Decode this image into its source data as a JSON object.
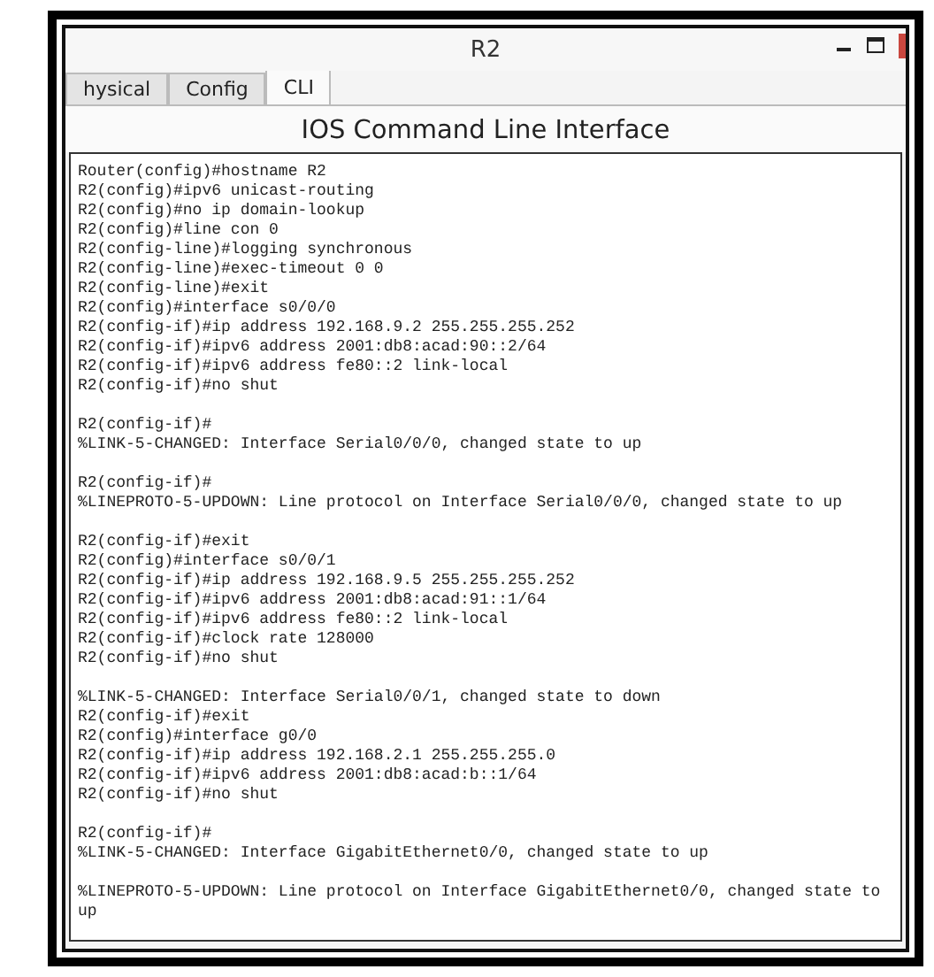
{
  "window": {
    "title": "R2"
  },
  "tabs": [
    {
      "label": "hysical",
      "selected": false
    },
    {
      "label": "Config",
      "selected": false
    },
    {
      "label": "CLI",
      "selected": true
    }
  ],
  "header": "IOS Command Line Interface",
  "console_blocks": [
    [
      "Router(config)#hostname R2",
      "R2(config)#ipv6 unicast-routing",
      "R2(config)#no ip domain-lookup",
      "R2(config)#line con 0",
      "R2(config-line)#logging synchronous",
      "R2(config-line)#exec-timeout 0 0",
      "R2(config-line)#exit",
      "R2(config)#interface s0/0/0",
      "R2(config-if)#ip address 192.168.9.2 255.255.255.252",
      "R2(config-if)#ipv6 address 2001:db8:acad:90::2/64",
      "R2(config-if)#ipv6 address fe80::2 link-local",
      "R2(config-if)#no shut"
    ],
    [
      "R2(config-if)#",
      "%LINK-5-CHANGED: Interface Serial0/0/0, changed state to up"
    ],
    [
      "R2(config-if)#",
      "%LINEPROTO-5-UPDOWN: Line protocol on Interface Serial0/0/0, changed state to up"
    ],
    [
      "R2(config-if)#exit",
      "R2(config)#interface s0/0/1",
      "R2(config-if)#ip address 192.168.9.5 255.255.255.252",
      "R2(config-if)#ipv6 address 2001:db8:acad:91::1/64",
      "R2(config-if)#ipv6 address fe80::2 link-local",
      "R2(config-if)#clock rate 128000",
      "R2(config-if)#no shut"
    ],
    [
      "%LINK-5-CHANGED: Interface Serial0/0/1, changed state to down",
      "R2(config-if)#exit",
      "R2(config)#interface g0/0",
      "R2(config-if)#ip address 192.168.2.1 255.255.255.0",
      "R2(config-if)#ipv6 address 2001:db8:acad:b::1/64",
      "R2(config-if)#no shut"
    ],
    [
      "R2(config-if)#",
      "%LINK-5-CHANGED: Interface GigabitEthernet0/0, changed state to up"
    ],
    [
      "%LINEPROTO-5-UPDOWN: Line protocol on Interface GigabitEthernet0/0, changed state to up"
    ]
  ]
}
